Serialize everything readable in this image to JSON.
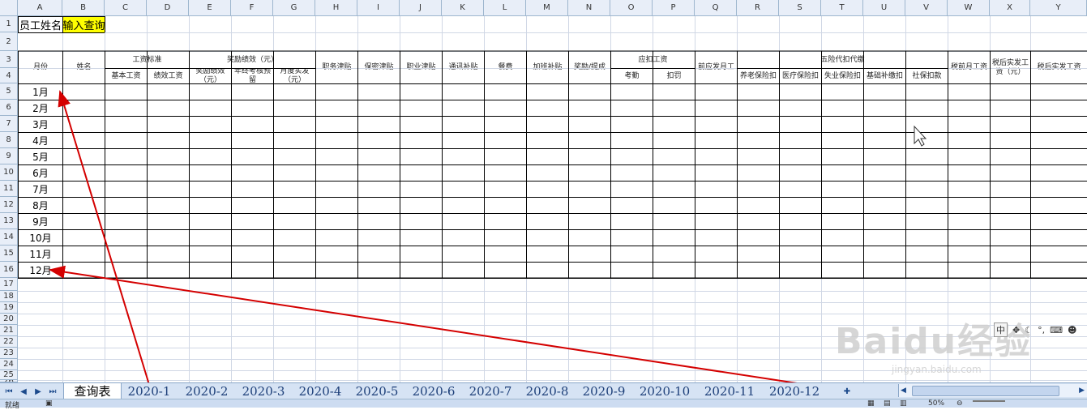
{
  "columns": [
    "A",
    "B",
    "C",
    "D",
    "E",
    "F",
    "G",
    "H",
    "I",
    "J",
    "K",
    "L",
    "M",
    "N",
    "O",
    "P",
    "Q",
    "R",
    "S",
    "T",
    "U",
    "V",
    "W",
    "X",
    "Y"
  ],
  "rows": [
    "1",
    "2",
    "3",
    "4",
    "5",
    "6",
    "7",
    "8",
    "9",
    "10",
    "11",
    "12",
    "13",
    "14",
    "15",
    "16",
    "17",
    "18",
    "19",
    "20",
    "21",
    "22",
    "23",
    "24",
    "25",
    "26",
    "27"
  ],
  "cells": {
    "a1": "员工姓名",
    "b1": "输入查询",
    "month_header": "月份",
    "name_header": "姓名",
    "wage_std": "工资标准",
    "base_wage": "基本工资",
    "perf_wage": "绩效工资",
    "bonus_group": "奖励绩效（元）",
    "bonus_perf": "奖励绩效（元）",
    "year_end": "年终考核预留",
    "monthly_actual": "月度实发（元）",
    "duty_allow": "职务津贴",
    "secrecy_allow": "保密津贴",
    "pro_allow": "职业津贴",
    "comm_allow": "通讯补贴",
    "meal": "餐费",
    "overtime": "加班补贴",
    "commission": "奖励/提成",
    "deduct_group": "应扣工资",
    "attendance": "考勤",
    "deduction": "扣罚",
    "pre_pay": "前应发月工",
    "insurance_group": "五险代扣代缴",
    "pension": "养老保险扣",
    "medical": "医疗保险扣",
    "unemploy": "失业保险扣",
    "supplement": "基础补缴扣",
    "social": "社保扣款",
    "pretax": "税前月工资",
    "aftertax_yuan": "税后实发工资（元）",
    "aftertax": "税后实发工资"
  },
  "months": [
    "1月",
    "2月",
    "3月",
    "4月",
    "5月",
    "6月",
    "7月",
    "8月",
    "9月",
    "10月",
    "11月",
    "12月"
  ],
  "sheet_tabs": [
    "查询表",
    "2020-1",
    "2020-2",
    "2020-3",
    "2020-4",
    "2020-5",
    "2020-6",
    "2020-7",
    "2020-8",
    "2020-9",
    "2020-10",
    "2020-11",
    "2020-12"
  ],
  "active_tab": "查询表",
  "status": {
    "ready": "就绪",
    "zoom": "50%"
  },
  "watermark": {
    "logo": "Baidu经验",
    "url": "jingyan.baidu.com"
  },
  "colors": {
    "highlight": "#ffff00",
    "arrow": "#d40000",
    "header_bg": "#e8eef8",
    "grid": "#d0d7e5"
  }
}
